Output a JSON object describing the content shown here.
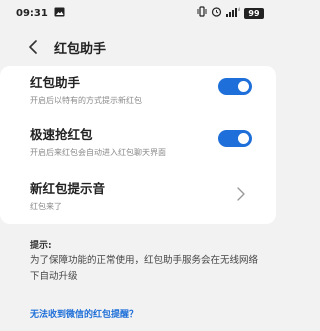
{
  "status_bar": {
    "time": "09:31",
    "battery": "99",
    "icons": [
      "image-icon",
      "vibrate-icon",
      "alarm-icon",
      "signal-icon",
      "battery-icon"
    ]
  },
  "header": {
    "title": "红包助手",
    "back_icon": "chevron-left-icon"
  },
  "settings": [
    {
      "label": "红包助手",
      "sub": "开启后以特有的方式提示新红包",
      "toggle_on": true
    },
    {
      "label": "极速抢红包",
      "sub": "开启后来红包会自动进入红包聊天界面",
      "toggle_on": true
    },
    {
      "label": "新红包提示音",
      "sub": "红包来了",
      "chevron": "chevron-right-icon"
    }
  ],
  "tips": {
    "title": "提示:",
    "body": "为了保障功能的正常使用，红包助手服务会在无线网络下自动升级"
  },
  "help_link": "无法收到微信的红包提醒？",
  "colors": {
    "accent": "#1e6fd9",
    "background": "#f2f2f2",
    "card": "#ffffff"
  }
}
